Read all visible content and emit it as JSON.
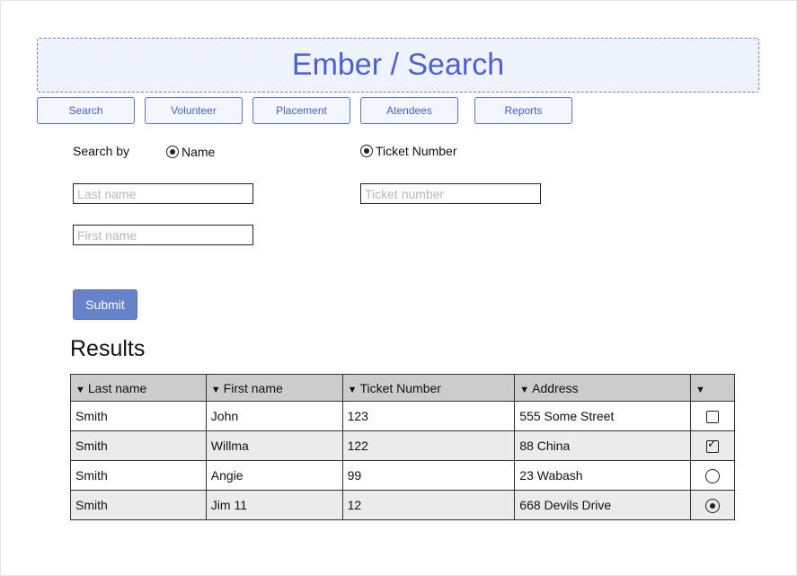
{
  "header": {
    "title": "Ember / Search"
  },
  "nav": [
    {
      "label": "Search"
    },
    {
      "label": "Volunteer"
    },
    {
      "label": "Placement"
    },
    {
      "label": "Atendees"
    },
    {
      "label": "Reports"
    }
  ],
  "search": {
    "search_by_label": "Search by",
    "options": [
      {
        "label": "Name",
        "selected": true
      },
      {
        "label": "Ticket Number",
        "selected": true
      }
    ],
    "last_name": {
      "value": "",
      "placeholder": "Last name"
    },
    "first_name": {
      "value": "",
      "placeholder": "First name"
    },
    "ticket_number": {
      "value": "",
      "placeholder": "Ticket number"
    },
    "submit_label": "Submit"
  },
  "results": {
    "title": "Results",
    "columns": [
      "Last name",
      "First name",
      "Ticket Number",
      "Address",
      ""
    ],
    "rows": [
      {
        "last": "Smith",
        "first": "John",
        "ticket": "123",
        "address": "555 Some Street",
        "control": "checkbox",
        "checked": false
      },
      {
        "last": "Smith",
        "first": "Willma",
        "ticket": "122",
        "address": "88 China",
        "control": "checkbox",
        "checked": true
      },
      {
        "last": "Smith",
        "first": "Angie",
        "ticket": "99",
        "address": "23 Wabash",
        "control": "radio",
        "checked": false
      },
      {
        "last": "Smith",
        "first": "Jim 11",
        "ticket": "12",
        "address": "668 Devils Drive",
        "control": "radio",
        "checked": true
      }
    ]
  },
  "colors": {
    "accent": "#4c5fd5",
    "header_bg": "#eef3fd",
    "submit_bg": "#6683c9"
  }
}
